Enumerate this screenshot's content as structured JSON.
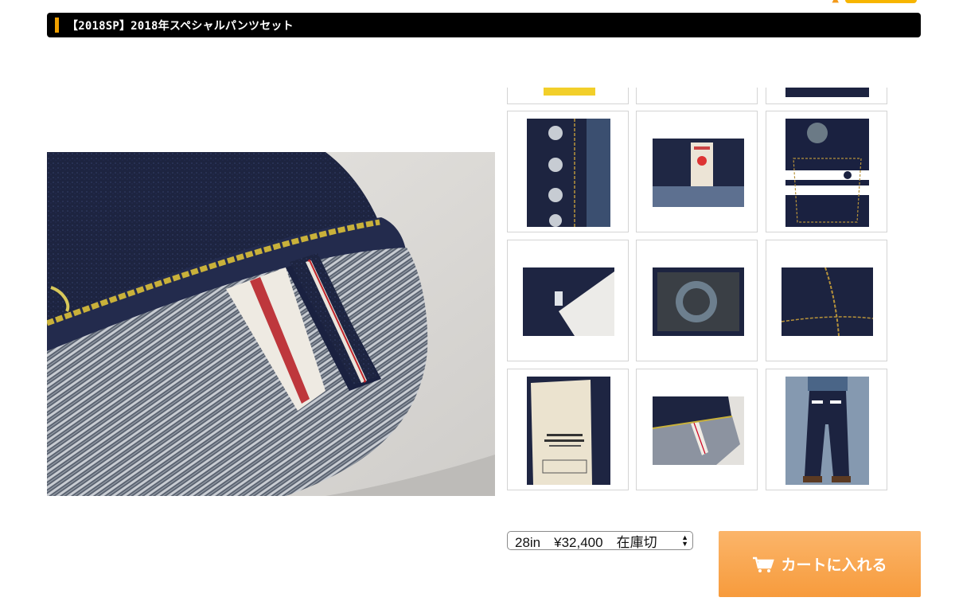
{
  "product": {
    "title": "【2018SP】2018年スペシャルパンツセット"
  },
  "gallery": {
    "main_image": "selvedge-cuff-closeup",
    "thumbnails": [
      "yellow-tag",
      "blank",
      "denim-bottom",
      "button-fly",
      "red-tab-label",
      "back-pocket-stripes",
      "white-care-tag",
      "leather-patch",
      "side-seam",
      "pocket-lining-print",
      "selvedge-cuff",
      "model-back-view"
    ]
  },
  "purchase": {
    "size_option": "28in　¥32,400　在庫切",
    "cart_label": "カートに入れる"
  },
  "colors": {
    "title_bar": "#000000",
    "accent": "#f0a000",
    "cart_button": "#f9a851"
  }
}
